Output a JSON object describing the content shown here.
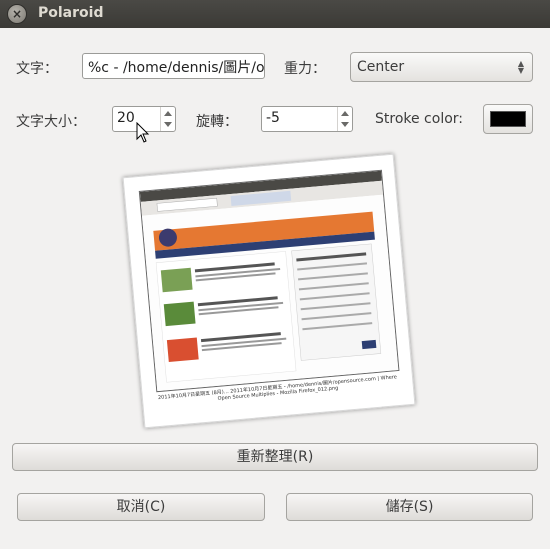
{
  "window": {
    "title": "Polaroid"
  },
  "form": {
    "text_label": "文字：",
    "text_value": "%c - /home/dennis/圖片/o",
    "gravity_label": "重力：",
    "gravity_value": "Center",
    "text_size_label": "文字大小：",
    "text_size_value": "20",
    "rotate_label": "旋轉：",
    "rotate_value": "-5",
    "stroke_color_label": "Stroke color:",
    "stroke_color": "#000000"
  },
  "preview": {
    "caption": "2011年10月7日星期五 (8月)… 2011年10月7日星期五 - /home/dennis/圖片/opensource.com | Where Open Source Multiplies - Mozilla Firefox_012.png"
  },
  "buttons": {
    "refresh": "重新整理(R)",
    "cancel": "取消(C)",
    "save": "儲存(S)"
  },
  "icons": {
    "close": "close-icon",
    "cursor": "mouse-cursor-icon"
  }
}
